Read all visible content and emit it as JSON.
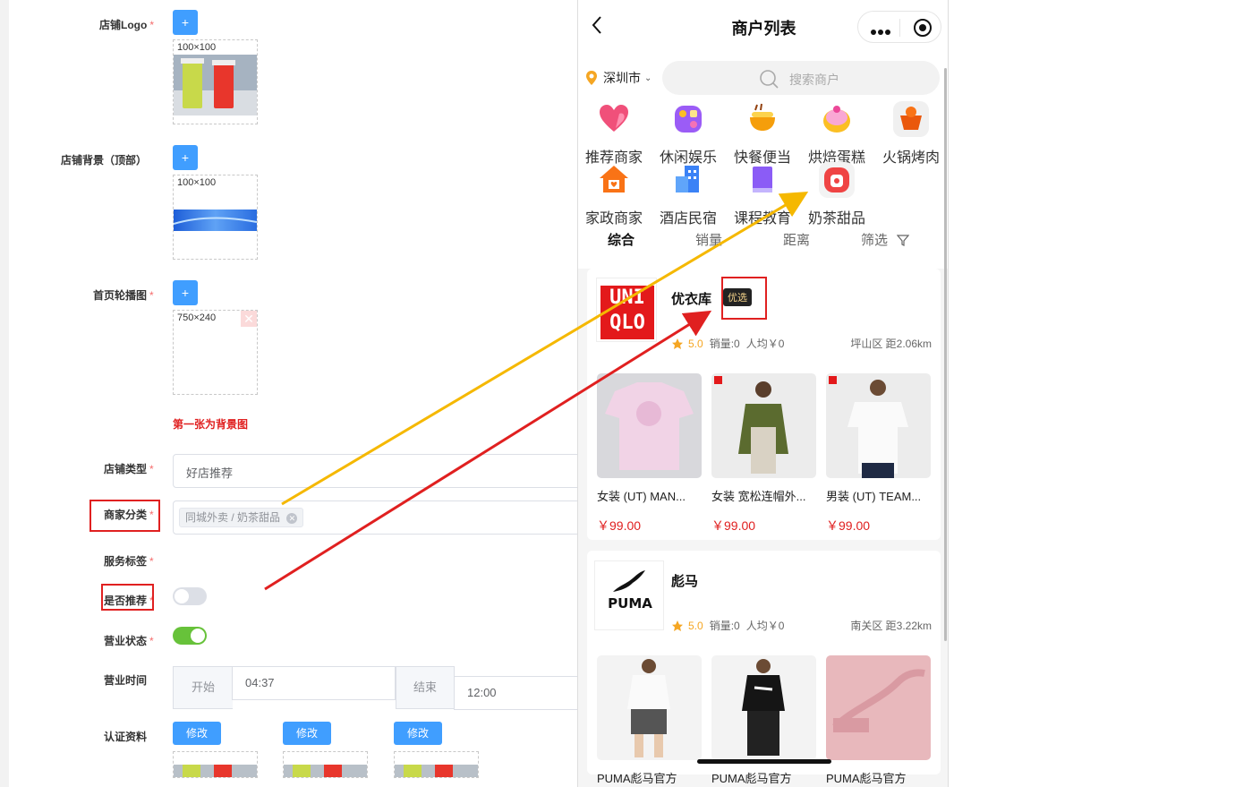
{
  "form": {
    "logo_label": "店铺Logo",
    "bg_label": "店铺背景（顶部）",
    "banner_label": "首页轮播图",
    "add_symbol": "+",
    "size_100": "100×100",
    "size_750": "750×240",
    "banner_hint": "第一张为背景图",
    "type_label": "店铺类型",
    "type_value": "好店推荐",
    "category_label": "商家分类",
    "category_tag": "同城外卖 / 奶茶甜品",
    "service_label": "服务标签",
    "recommend_label": "是否推荐",
    "status_label": "营业状态",
    "hours_label": "营业时间",
    "hours_start_label": "开始",
    "hours_start_value": "04:37",
    "hours_end_label": "结束",
    "hours_end_value": "12:00",
    "cert_label": "认证资料",
    "modify_label": "修改",
    "required_mark": "*",
    "recommend_on": false,
    "status_on": true
  },
  "phone": {
    "title": "商户列表",
    "back_icon": "chevron-left-icon",
    "more_icon": "more-dots-icon",
    "target_icon": "target-icon",
    "city": "深圳市",
    "search_placeholder": "搜索商户",
    "categories": [
      {
        "label": "推荐商家",
        "icon": "heart-icon",
        "color": "#f0507a"
      },
      {
        "label": "休闲娱乐",
        "icon": "gamepad-icon",
        "color": "#9b5cf6"
      },
      {
        "label": "快餐便当",
        "icon": "noodle-bowl-icon",
        "color": "#f59e0b"
      },
      {
        "label": "烘焙蛋糕",
        "icon": "cake-icon",
        "color": "#f472b6"
      },
      {
        "label": "火锅烤肉",
        "icon": "hotpot-icon",
        "color": "#ea580c"
      },
      {
        "label": "家政商家",
        "icon": "house-icon",
        "color": "#f97316"
      },
      {
        "label": "酒店民宿",
        "icon": "hotel-icon",
        "color": "#3b82f6"
      },
      {
        "label": "课程教育",
        "icon": "book-icon",
        "color": "#8b5cf6"
      },
      {
        "label": "奶茶甜品",
        "icon": "milk-tea-icon",
        "color": "#ef4444"
      }
    ],
    "sort": [
      "综合",
      "销量",
      "距离",
      "筛选"
    ],
    "merchants": [
      {
        "name": "优衣库",
        "badge": "优选",
        "rating": "5.0",
        "sales": "销量:0",
        "avg": "人均￥0",
        "location": "坪山区 距2.06km",
        "logo_lines": [
          "UNI",
          "QLO"
        ],
        "products": [
          {
            "name": "女装 (UT) MAN...",
            "price": "￥99.00"
          },
          {
            "name": "女装 宽松连帽外...",
            "price": "￥99.00"
          },
          {
            "name": "男装 (UT) TEAM...",
            "price": "￥99.00"
          }
        ]
      },
      {
        "name": "彪马",
        "rating": "5.0",
        "sales": "销量:0",
        "avg": "人均￥0",
        "location": "南关区 距3.22km",
        "logo_text": "PUMA",
        "products": [
          {
            "name": "PUMA彪马官方"
          },
          {
            "name": "PUMA彪马官方"
          },
          {
            "name": "PUMA彪马官方"
          }
        ]
      }
    ]
  },
  "colors": {
    "primary": "#409eff",
    "required": "#f56c6c",
    "annotation_red": "#e02020",
    "annotation_yellow": "#f5b800",
    "toggle_on": "#67c23a",
    "toggle_off": "#dcdfe6",
    "price": "#e02020"
  }
}
